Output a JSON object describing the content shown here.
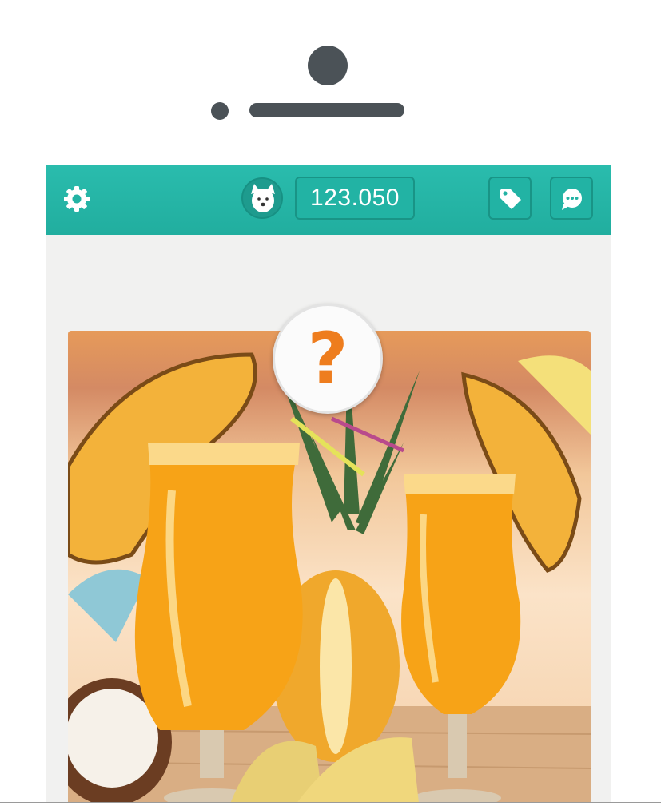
{
  "header": {
    "coins_value": "123.050",
    "accent_color": "#21ae9f",
    "icons": [
      "gear-icon",
      "dog-avatar-icon",
      "price-tag-icon",
      "chat-bubble-icon"
    ]
  },
  "puzzle": {
    "hint_symbol": "?",
    "hint_color": "#ee7d1e",
    "image_subject": "pineapple-juice-cocktails"
  }
}
